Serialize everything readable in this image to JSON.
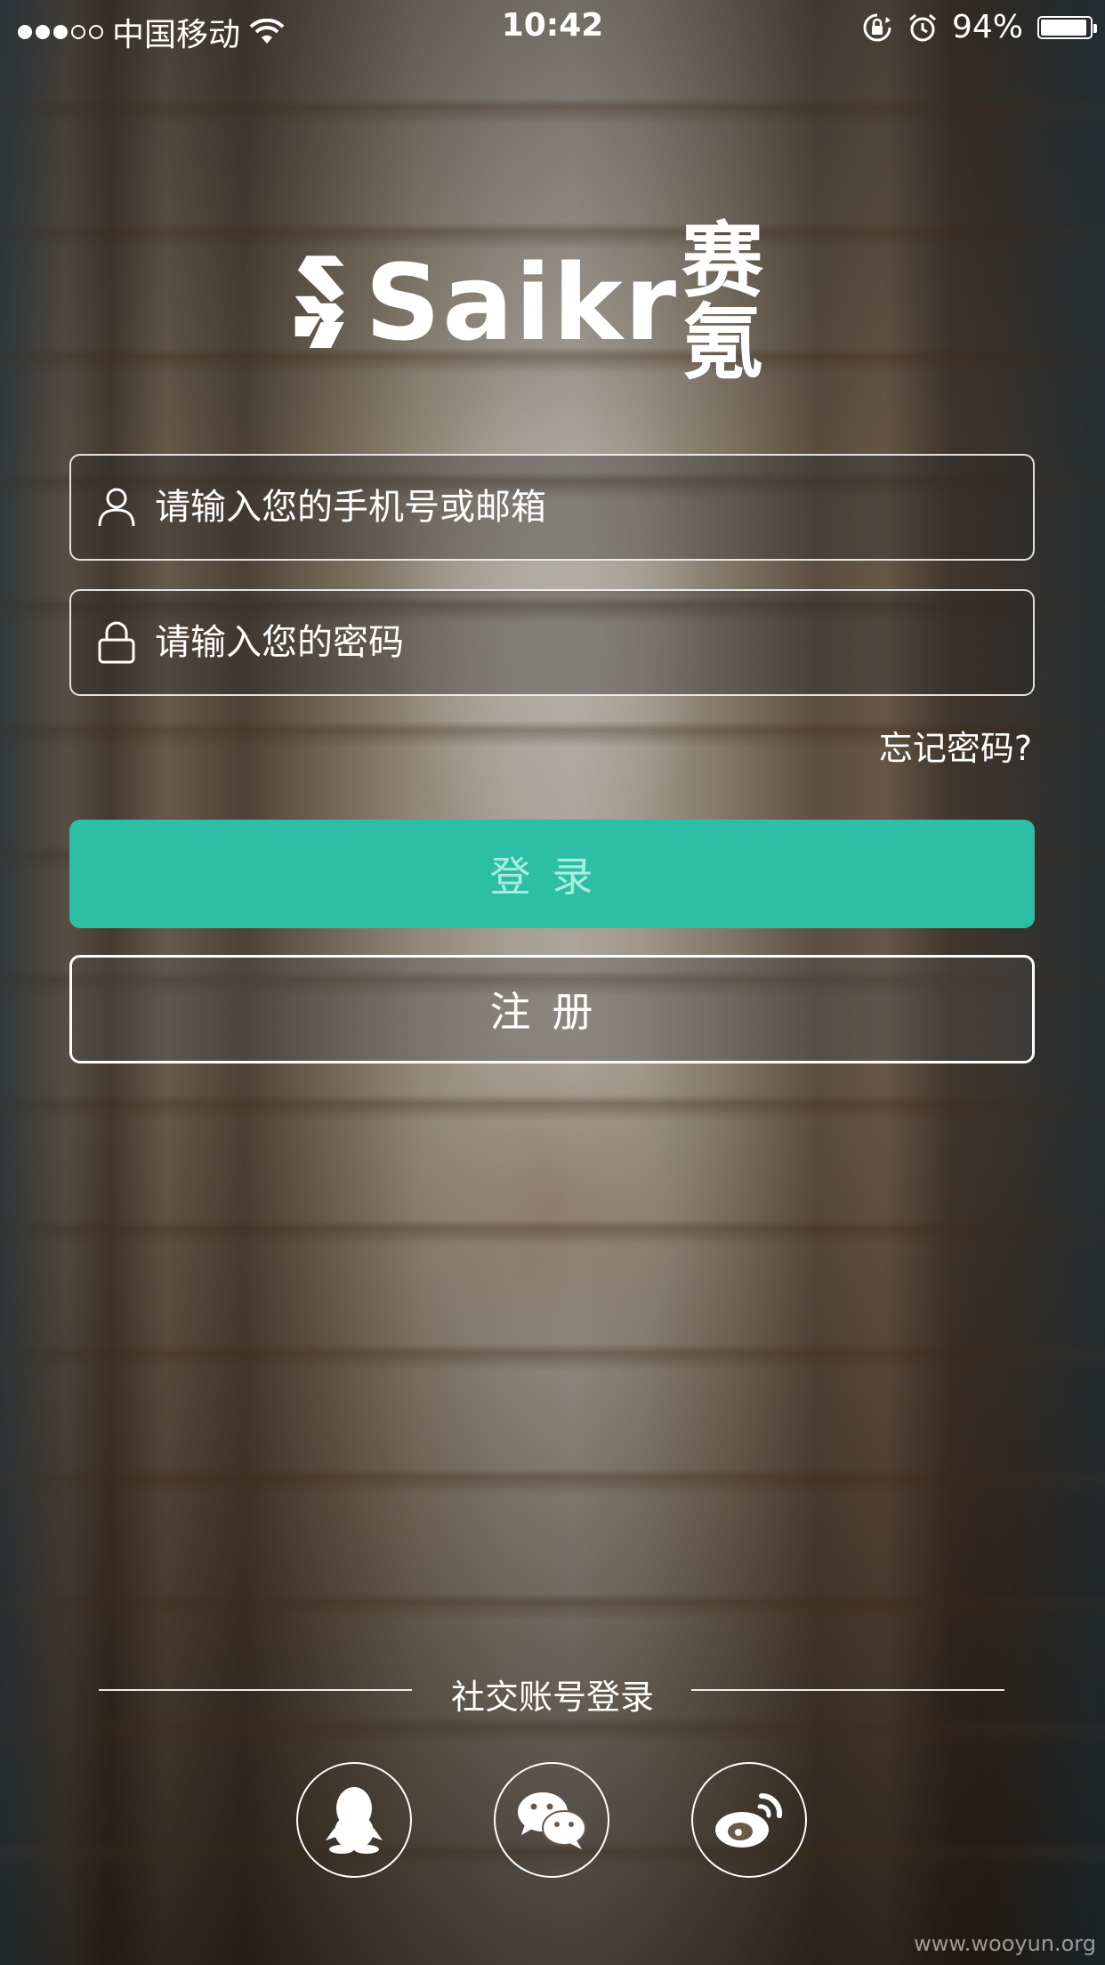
{
  "status_bar": {
    "signal_dots_filled": 3,
    "signal_dots_total": 5,
    "carrier": "中国移动",
    "time": "10:42",
    "battery_percent": "94%",
    "battery_level": 0.94,
    "icons": [
      "wifi-icon",
      "rotation-lock-icon",
      "alarm-icon",
      "battery-icon"
    ]
  },
  "logo": {
    "brand": "Saikr",
    "brand_cn": "赛氪"
  },
  "login_form": {
    "account_placeholder": "请输入您的手机号或邮箱",
    "password_placeholder": "请输入您的密码",
    "forgot_password": "忘记密码?",
    "login_button": "登录",
    "register_button": "注册"
  },
  "social": {
    "title": "社交账号登录",
    "providers": [
      "qq-icon",
      "wechat-icon",
      "weibo-icon"
    ]
  },
  "watermark": "www.wooyun.org",
  "colors": {
    "accent": "#2cbfa6",
    "login_text": "#a8eedd"
  }
}
